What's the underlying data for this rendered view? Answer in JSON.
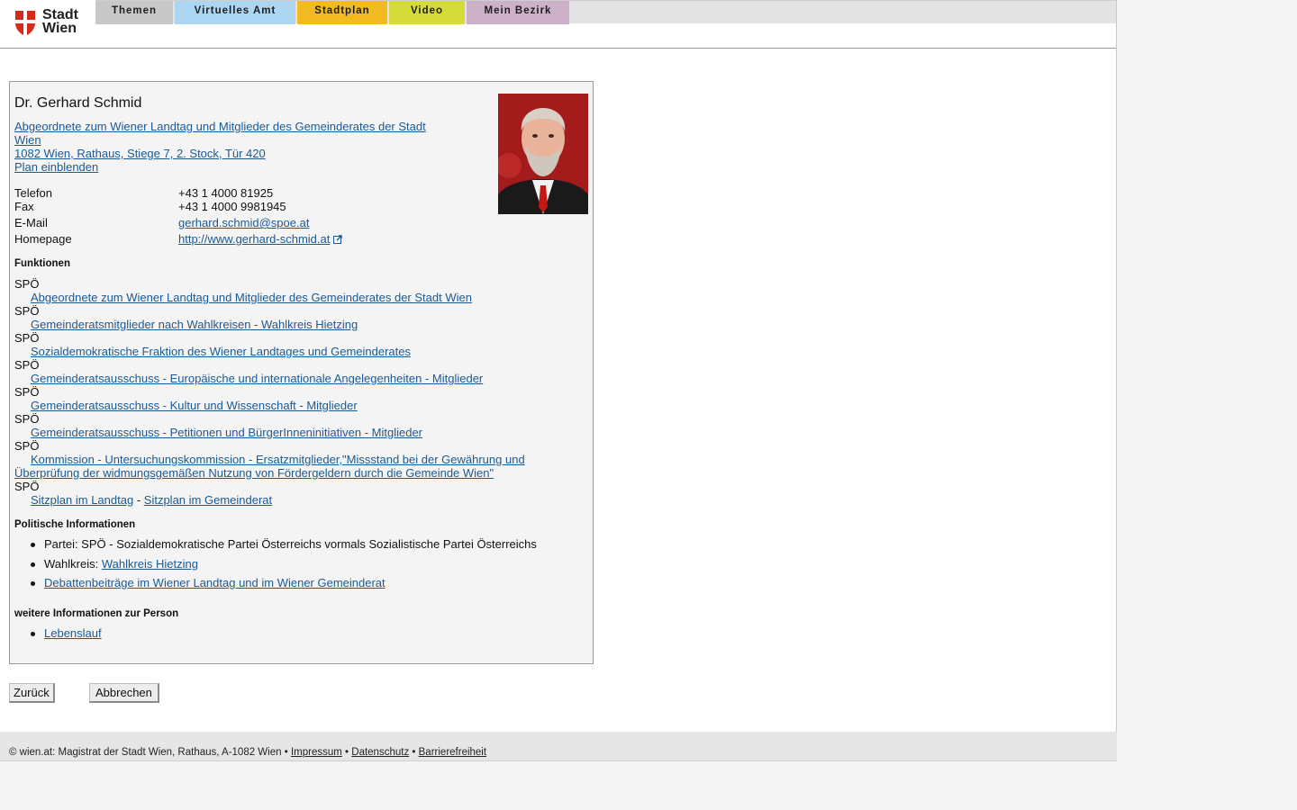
{
  "logo": {
    "line1": "Stadt",
    "line2": "Wien"
  },
  "nav": [
    {
      "label": "Themen",
      "color": "#c8c8c8"
    },
    {
      "label": "Virtuelles Amt",
      "color": "#abd5f1"
    },
    {
      "label": "Stadtplan",
      "color": "#f3bb22"
    },
    {
      "label": "Video",
      "color": "#d5dc3a"
    },
    {
      "label": "Mein Bezirk",
      "color": "#cdb1c9"
    }
  ],
  "person": {
    "name": "Dr. Gerhard Schmid",
    "org_line1": "Abgeordnete zum Wiener Landtag und Mitglieder des Gemeinderates der Stadt",
    "org_line2": "Wien",
    "address": "1082 Wien, Rathaus, Stiege 7, 2. Stock, Tür 420",
    "plan_link": "Plan einblenden"
  },
  "contact": {
    "phone_label": "Telefon",
    "phone": "+43 1 4000 81925",
    "fax_label": "Fax",
    "fax": "+43 1 4000 9981945",
    "email_label": "E-Mail",
    "email": "gerhard.schmid@spoe.at",
    "homepage_label": "Homepage",
    "homepage": "http://www.gerhard-schmid.at"
  },
  "functions": {
    "heading": "Funktionen",
    "party": "SPÖ",
    "items": [
      "Abgeordnete zum Wiener Landtag und Mitglieder des Gemeinderates der Stadt Wien",
      "Gemeinderatsmitglieder nach Wahlkreisen - Wahlkreis Hietzing",
      "Sozialdemokratische Fraktion des Wiener Landtages und Gemeinderates",
      "Gemeinderatsausschuss - Europäische und internationale Angelegenheiten - Mitglieder",
      "Gemeinderatsausschuss - Kultur und Wissenschaft - Mitglieder",
      "Gemeinderatsausschuss - Petitionen und BürgerInneninitiativen - Mitglieder"
    ],
    "commission_line1": "Kommission - Untersuchungskommission - Ersatzmitglieder,\"Missstand bei der Gewährung und",
    "commission_line2": "Überprüfung der widmungsgemäßen Nutzung von Fördergeldern durch die Gemeinde Wien\"",
    "seat_landtag": "Sitzplan im Landtag",
    "seat_sep": "-",
    "seat_gemeinderat": "Sitzplan im Gemeinderat"
  },
  "political": {
    "heading": "Politische Informationen",
    "party_text": "Partei: SPÖ - Sozialdemokratische Partei Österreichs vormals Sozialistische Partei Österreichs",
    "district_label": "Wahlkreis:",
    "district_link": "Wahlkreis Hietzing",
    "debate_link": "Debattenbeiträge im Wiener Landtag und im Wiener Gemeinderat"
  },
  "more": {
    "heading": "weitere Informationen zur Person",
    "cv_link": "Lebenslauf"
  },
  "buttons": {
    "back": "Zurück",
    "cancel": "Abbrechen"
  },
  "footer": {
    "copyright": "© wien.at: Magistrat der Stadt Wien, Rathaus, A-1082 Wien",
    "sep": "•",
    "impressum": "Impressum",
    "datenschutz": "Datenschutz",
    "barrierefreiheit": "Barrierefreiheit"
  }
}
